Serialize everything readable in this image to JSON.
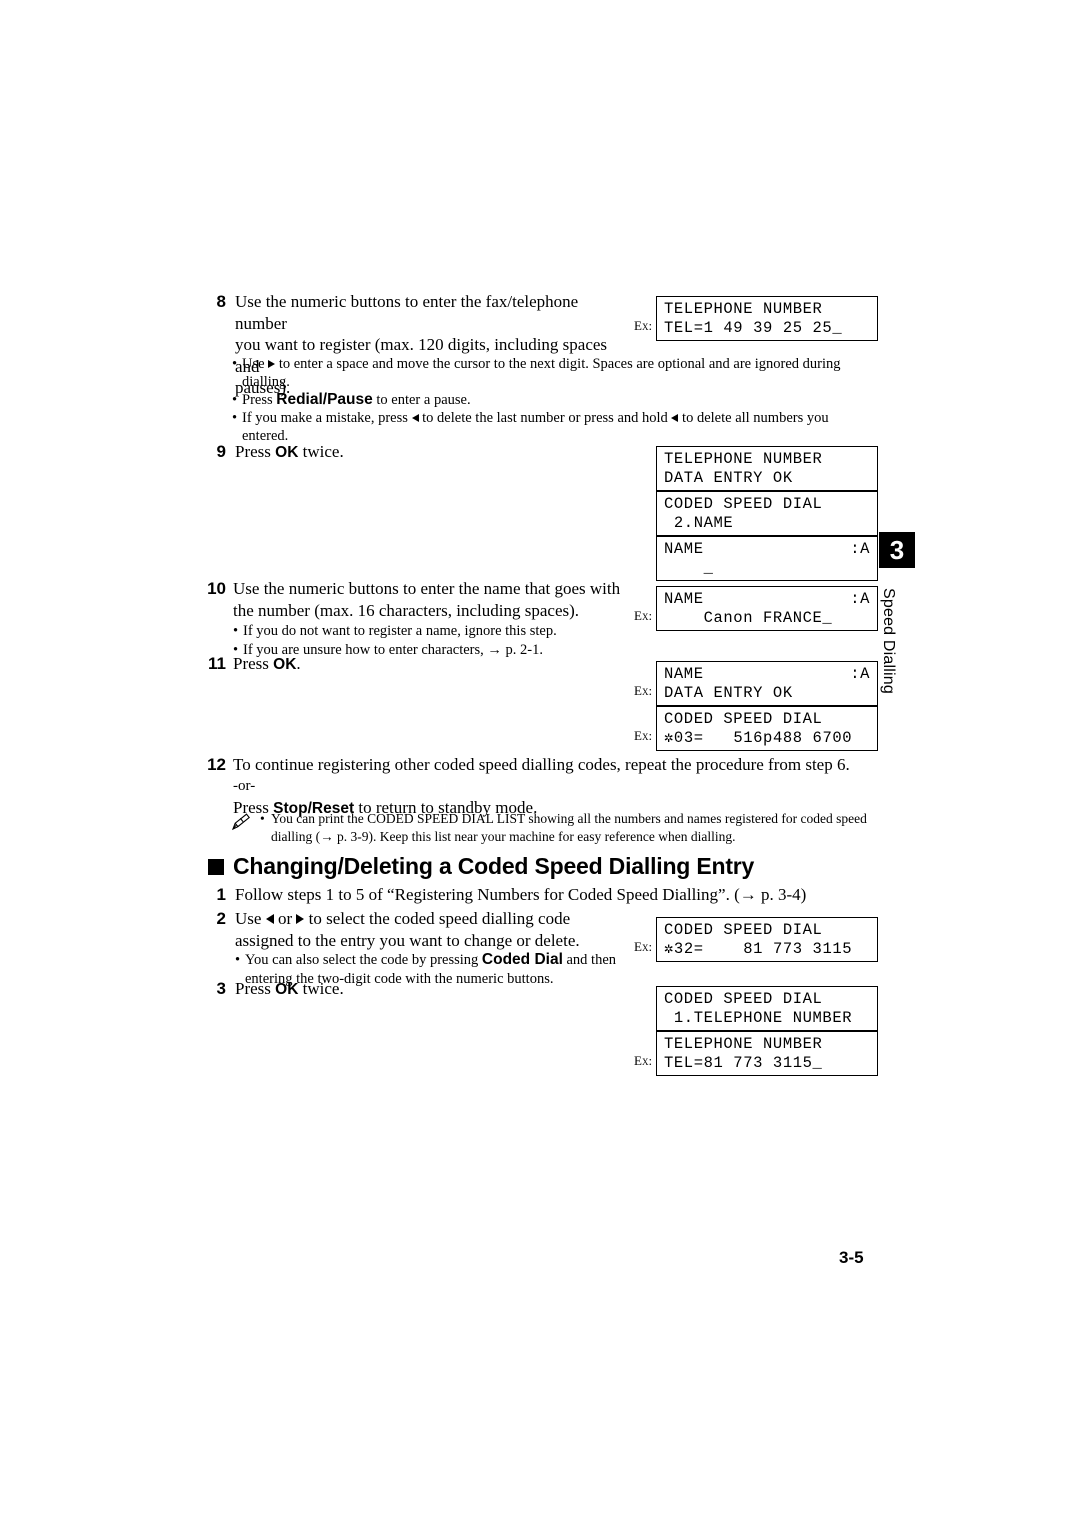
{
  "chapter": {
    "number": "3",
    "label": "Speed Dialling"
  },
  "page_number": "3-5",
  "steps": [
    {
      "num": "8",
      "text_lines": [
        "Use the numeric buttons to enter the fax/telephone number",
        "you want to register (max. 120 digits, including spaces and",
        "pauses)."
      ]
    },
    {
      "num": "9",
      "text": "Press OK twice.",
      "pre": "Press ",
      "bold": "OK",
      "post": " twice."
    },
    {
      "num": "10",
      "text_lines": [
        "Use the numeric buttons to enter the name that goes with",
        "the number (max. 16 characters, including spaces)."
      ]
    },
    {
      "num": "11",
      "pre": "Press ",
      "bold": "OK",
      "post": "."
    },
    {
      "num": "12",
      "line1": "To continue registering other coded speed dialling codes, repeat the procedure from step 6.",
      "line2": "-or-",
      "line3_pre": "Press ",
      "line3_bold": "Stop/Reset",
      "line3_post": " to return to standby mode."
    }
  ],
  "step8_bullets": [
    {
      "pre": "Use ",
      "arrow": "right-arrow-icon",
      "post": " to enter a space and move the cursor to the next digit. Spaces are optional and are ignored during",
      "cont": "dialling."
    },
    {
      "pre": "Press ",
      "bold": "Redial/Pause",
      "post": " to enter a pause."
    },
    {
      "pre": "If you make a mistake, press ",
      "arrow": "left-arrow-icon",
      "mid": " to delete the last number or press and hold ",
      "arrow2": "left-arrow-icon",
      "post": " to delete all numbers you",
      "cont": "entered."
    }
  ],
  "step10_bullets": [
    {
      "text": "If you do not want to register a name, ignore this step."
    },
    {
      "text": "If you are unsure how to enter characters, → p. 2-1."
    }
  ],
  "note": {
    "icon": "pencil-icon",
    "line1": "You can print the CODED SPEED DIAL LIST showing all the numbers and names registered for coded speed",
    "line2": "dialling (→ p. 3-9). Keep this list near your machine for easy reference when dialling."
  },
  "section_heading": "Changing/Deleting a Coded Speed Dialling Entry",
  "section_steps": [
    {
      "num": "1",
      "text": "Follow steps 1 to 5 of “Registering Numbers for Coded Speed Dialling”. (→ p. 3-4)"
    },
    {
      "num": "2",
      "line1_pre": "Use ",
      "line1_arrow_l": "left-arrow-icon",
      "line1_mid": " or ",
      "line1_arrow_r": "right-arrow-icon",
      "line1_post": " to select the coded speed dialling code",
      "line2": "assigned to the entry you want to change or delete.",
      "bullet_pre": "You can also select the code by pressing ",
      "bullet_bold": "Coded Dial",
      "bullet_post": " and then",
      "bullet_cont": "entering the two-digit code with the numeric buttons."
    },
    {
      "num": "3",
      "pre": "Press ",
      "bold": "OK",
      "post": " twice."
    }
  ],
  "lcd_panels": [
    {
      "id": "lcd-tel-number-entry",
      "ex": "Ex:",
      "line1": "TELEPHONE NUMBER",
      "line2": "TEL=1 49 39 25 25_"
    },
    {
      "id": "lcd-tel-number-ok",
      "ex": "",
      "line1": "TELEPHONE NUMBER",
      "line2": "DATA ENTRY OK"
    },
    {
      "id": "lcd-coded-speed-dial-name",
      "ex": "",
      "line1": "CODED SPEED DIAL",
      "line2": " 2.NAME"
    },
    {
      "id": "lcd-name-blank",
      "ex": "",
      "line1_left": "NAME",
      "line1_right": ":A",
      "line2": "    _"
    },
    {
      "id": "lcd-name-canon-france",
      "ex": "Ex:",
      "line1_left": "NAME",
      "line1_right": ":A",
      "line2": "    Canon FRANCE_"
    },
    {
      "id": "lcd-name-data-entry-ok",
      "ex": "Ex:",
      "line1_left": "NAME",
      "line1_right": ":A",
      "line2": "DATA ENTRY OK"
    },
    {
      "id": "lcd-coded-speed-dial-03",
      "ex": "Ex:",
      "line1": "CODED SPEED DIAL",
      "line2": "✲03=   516p488 6700"
    },
    {
      "id": "lcd-coded-speed-dial-32",
      "ex": "Ex:",
      "line1": "CODED SPEED DIAL",
      "line2": "✲32=    81 773 3115"
    },
    {
      "id": "lcd-coded-speed-dial-1tel",
      "ex": "",
      "line1": "CODED SPEED DIAL",
      "line2": " 1.TELEPHONE NUMBER"
    },
    {
      "id": "lcd-tel-number-81",
      "ex": "Ex:",
      "line1": "TELEPHONE NUMBER",
      "line2": "TEL=81 773 3115_"
    }
  ]
}
